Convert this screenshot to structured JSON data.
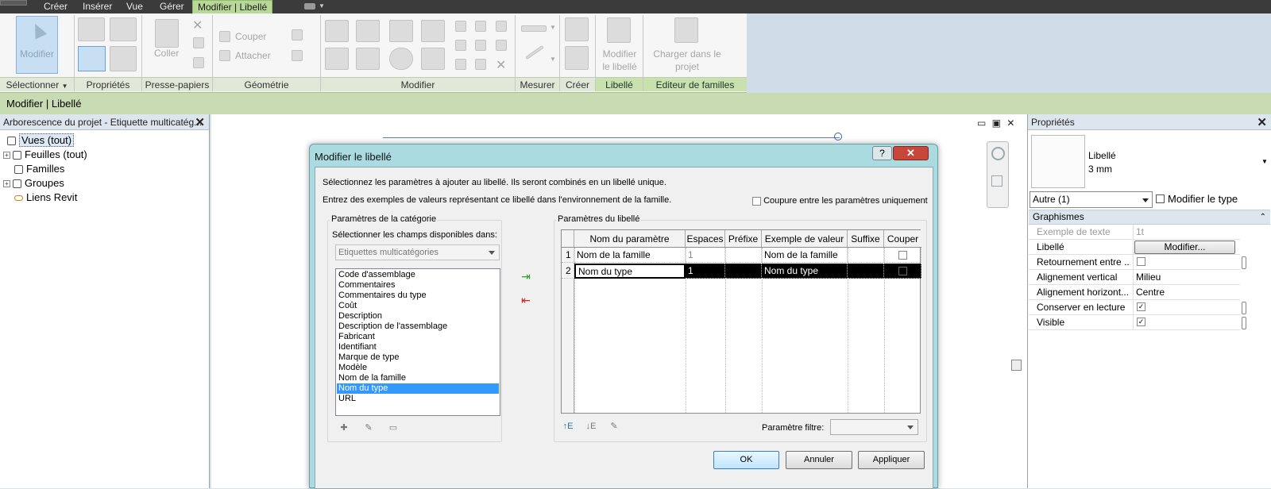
{
  "menu": {
    "tabs": [
      "Créer",
      "Insérer",
      "Vue",
      "Gérer",
      "Modifier | Libellé"
    ]
  },
  "ribbon": {
    "modifier_label": "Modifier",
    "coller_label": "Coller",
    "couper_label": "Couper",
    "attacher_label": "Attacher",
    "modifier_libelle_label": "Modifier le libellé",
    "charger_label": "Charger dans le projet",
    "panels": {
      "selectionner": "Sélectionner",
      "proprietes": "Propriétés",
      "presse_papiers": "Presse-papiers",
      "geometrie": "Géométrie",
      "modifier": "Modifier",
      "mesurer": "Mesurer",
      "creer": "Créer",
      "libelle": "Libellé",
      "editeur": "Editeur de familles"
    }
  },
  "context_bar": {
    "title": "Modifier | Libellé"
  },
  "project_browser": {
    "title": "Arborescence du projet - Etiquette multicatég...",
    "items": [
      {
        "label": "Vues (tout)"
      },
      {
        "label": "Feuilles (tout)"
      },
      {
        "label": "Familles"
      },
      {
        "label": "Groupes"
      },
      {
        "label": "Liens Revit"
      }
    ]
  },
  "dialog": {
    "title": "Modifier le libellé",
    "help": "?",
    "intro1": "Sélectionnez les paramètres à ajouter au libellé. Ils seront combinés en un libellé unique.",
    "intro2": "Entrez des exemples de valeurs représentant ce libellé dans l'environnement de la famille.",
    "wrap_only_label": "Coupure entre les paramètres uniquement",
    "category_group": "Paramètres de la catégorie",
    "select_fields_label": "Sélectionner les champs disponibles dans:",
    "combo_value": "Etiquettes multicatégories",
    "available_fields": [
      "Code d'assemblage",
      "Commentaires",
      "Commentaires du type",
      "Coût",
      "Description",
      "Description de l'assemblage",
      "Fabricant",
      "Identifiant",
      "Marque de type",
      "Modèle",
      "Nom de la famille",
      "Nom du type",
      "URL"
    ],
    "selected_field": "Nom du type",
    "label_group": "Paramètres du libellé",
    "columns": [
      "Nom du paramètre",
      "Espaces",
      "Préfixe",
      "Exemple de valeur",
      "Suffixe",
      "Couper"
    ],
    "rows": [
      {
        "num": "1",
        "name": "Nom de la famille",
        "spaces": "1",
        "prefix": "",
        "sample": "Nom de la famille",
        "suffix": ""
      },
      {
        "num": "2",
        "name": "Nom du type",
        "spaces": "1",
        "prefix": "",
        "sample": "Nom du type",
        "suffix": ""
      }
    ],
    "filter_label": "Paramètre filtre:",
    "ok": "OK",
    "cancel": "Annuler",
    "apply": "Appliquer"
  },
  "properties": {
    "title": "Propriétés",
    "type_name": "Libellé",
    "type_size": "3 mm",
    "type_selector": "Autre (1)",
    "edit_type": "Modifier le type",
    "section": "Graphismes",
    "rows": [
      {
        "key": "Exemple de texte",
        "value": "1t"
      },
      {
        "key": "Libellé",
        "value": "Modifier..."
      },
      {
        "key": "Retournement entre ...",
        "value": ""
      },
      {
        "key": "Alignement vertical",
        "value": "Milieu"
      },
      {
        "key": "Alignement horizont...",
        "value": "Centre"
      },
      {
        "key": "Conserver en lecture",
        "value": "✓"
      },
      {
        "key": "Visible",
        "value": "✓"
      }
    ]
  },
  "colors": {
    "context_tab": "#b8d89a",
    "selection": "#3399ff",
    "dialog_frame": "#a9dbe1"
  }
}
